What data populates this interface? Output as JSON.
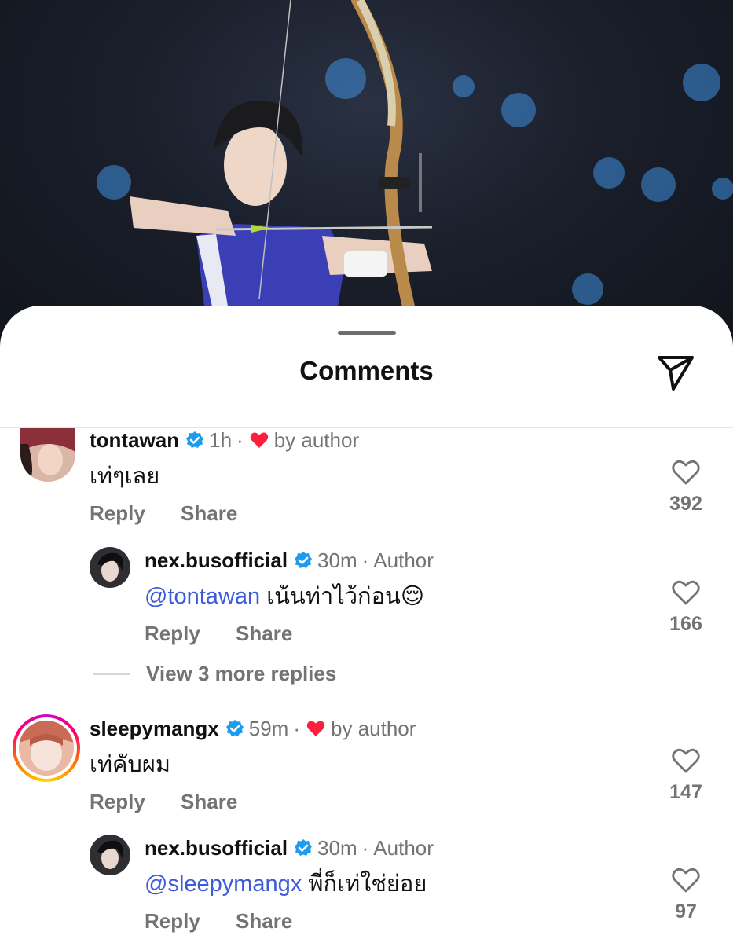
{
  "sheet": {
    "title": "Comments",
    "send_icon": "paper-plane-icon"
  },
  "threads": [
    {
      "user": "tontawan",
      "time": "1h",
      "separator": "·",
      "liked_by_author": "by author",
      "text": "เท่ๆเลย",
      "reply_label": "Reply",
      "share_label": "Share",
      "likes": "392",
      "replies": [
        {
          "user": "nex.busofficial",
          "time": "30m",
          "separator": "·",
          "tag": "Author",
          "mention": "@tontawan",
          "text": " เน้นท่าไว้ก่อน",
          "emoji": "😌",
          "reply_label": "Reply",
          "share_label": "Share",
          "likes": "166"
        }
      ],
      "more_replies": "View 3 more replies"
    },
    {
      "user": "sleepymangx",
      "time": "59m",
      "separator": "·",
      "liked_by_author": "by author",
      "text": "เท่คับผม",
      "reply_label": "Reply",
      "share_label": "Share",
      "likes": "147",
      "replies": [
        {
          "user": "nex.busofficial",
          "time": "30m",
          "separator": "·",
          "tag": "Author",
          "mention": "@sleepymangx",
          "text": " พี่ก็เท่ใช่ย่อย",
          "reply_label": "Reply",
          "share_label": "Share",
          "likes": "97"
        }
      ]
    }
  ],
  "colors": {
    "accent": "#3b5bdb",
    "verified": "#1d9bf0",
    "heart": "#ff1f3d",
    "muted": "#737373"
  }
}
